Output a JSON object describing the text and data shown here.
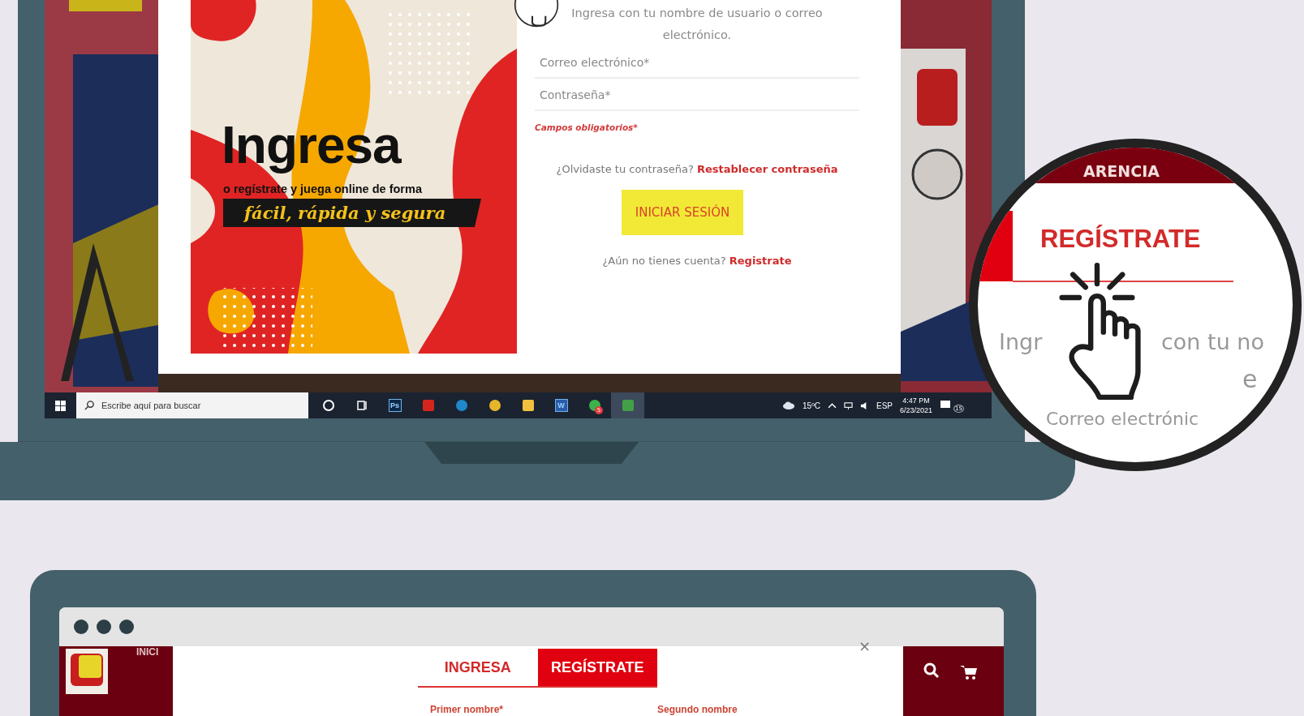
{
  "top_screen": {
    "login_modal": {
      "banner": {
        "title": "Ingresa",
        "subtitle": "o regístrate y juega online de forma",
        "tagline": "fácil, rápida y segura"
      },
      "instructions": "Ingresa con tu nombre de usuario o correo electrónico.",
      "fields": [
        {
          "placeholder": "Correo electrónico*"
        },
        {
          "placeholder": "Contraseña*"
        }
      ],
      "required_note": "Campos obligatorios*",
      "forgot": {
        "text": "¿Olvidaste tu contraseña?",
        "link": "Restablecer contraseña"
      },
      "submit": "INICIAR SESIÓN",
      "signup": {
        "text": "¿Aún no tienes cuenta?",
        "link": "Registrate"
      }
    },
    "taskbar": {
      "search_placeholder": "Escribe aquí para buscar",
      "apps": [
        {
          "kind": "cortana",
          "selected": false
        },
        {
          "kind": "taskview",
          "selected": false
        },
        {
          "kind": "photoshop",
          "label": "Ps",
          "selected": false
        },
        {
          "kind": "acrobat",
          "selected": false
        },
        {
          "kind": "edge",
          "selected": false
        },
        {
          "kind": "chrome",
          "selected": false
        },
        {
          "kind": "explorer",
          "selected": false
        },
        {
          "kind": "word",
          "label": "W",
          "selected": false
        },
        {
          "kind": "whatsapp",
          "badge": "5",
          "selected": false
        },
        {
          "kind": "sheet",
          "selected": true
        }
      ],
      "weather": "15ºC",
      "language": "ESP",
      "time": "4:47 PM",
      "date": "6/23/2021",
      "notification_count": "15"
    }
  },
  "magnifier": {
    "header_text": "ARENCIA",
    "tab": "REGÍSTRATE",
    "line_1_start": "Ingr",
    "line_1_end": "con tu no",
    "line_2": "e",
    "line_3": "Correo electrónic"
  },
  "bottom_screen": {
    "nav_item": "INICI",
    "tabs": [
      {
        "label": "INGRESA",
        "selected": false
      },
      {
        "label": "REGÍSTRATE",
        "selected": true
      }
    ],
    "close": "×",
    "field_labels": [
      "Primer nombre*",
      "Segundo nombre"
    ]
  }
}
